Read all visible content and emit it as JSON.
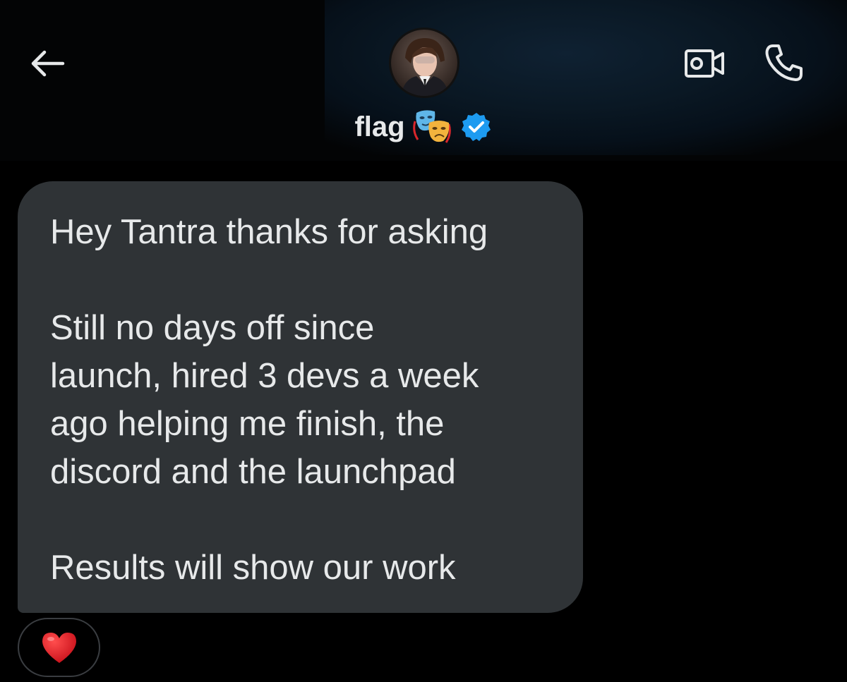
{
  "header": {
    "back_icon": "arrow-left-icon",
    "contact_name": "flag",
    "name_emoji": "performing-arts-masks-emoji",
    "verified_badge": "verified-badge-icon",
    "video_call_icon": "video-camera-icon",
    "voice_call_icon": "phone-icon",
    "accent_color": "#1d9bf0"
  },
  "message": {
    "lines": [
      "Hey Tantra thanks for asking",
      "",
      "Still no days off since",
      "launch, hired 3 devs a week",
      "ago helping me finish, the",
      "discord and the launchpad",
      "",
      "Results will show our work"
    ],
    "bubble_color": "#2f3336"
  },
  "reaction": {
    "emoji": "❤️",
    "icon": "red-heart-icon"
  }
}
